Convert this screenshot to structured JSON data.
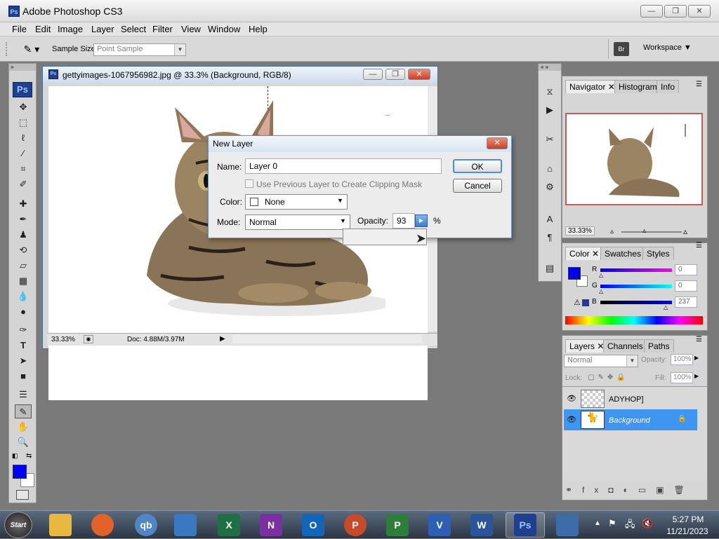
{
  "app": {
    "title": "Adobe Photoshop CS3",
    "icon_text": "Ps"
  },
  "window_buttons": {
    "minimize": "—",
    "restore": "❐",
    "close": "✕"
  },
  "menu": [
    "File",
    "Edit",
    "Image",
    "Layer",
    "Select",
    "Filter",
    "View",
    "Window",
    "Help"
  ],
  "options": {
    "sample_size_label": "Sample Size:",
    "sample_size_value": "Point Sample",
    "workspace_label": "Workspace ▼"
  },
  "toolbox": {
    "logo": "Ps",
    "tools": [
      "move-tool",
      "marquee-tool",
      "lasso-tool",
      "quick-select-tool",
      "crop-tool",
      "slice-tool",
      "healing-brush-tool",
      "brush-tool",
      "clone-stamp-tool",
      "history-brush-tool",
      "eraser-tool",
      "gradient-tool",
      "blur-tool",
      "dodge-tool",
      "pen-tool",
      "type-tool",
      "path-select-tool",
      "shape-tool",
      "notes-tool",
      "eyedropper-tool",
      "hand-tool",
      "zoom-tool"
    ],
    "foreground_color": "#0000ff",
    "background_color": "#ffffff"
  },
  "document": {
    "title": "gettyimages-1067956982.jpg @ 33.3% (Background, RGB/8)",
    "zoom": "33.33%",
    "doc_info": "Doc: 4.88M/3.97M"
  },
  "navigator": {
    "tabs": [
      "Navigator",
      "Histogram",
      "Info"
    ],
    "zoom": "33.33%"
  },
  "color_panel": {
    "tabs": [
      "Color",
      "Swatches",
      "Styles"
    ],
    "r_label": "R",
    "g_label": "G",
    "b_label": "B",
    "r_value": "0",
    "g_value": "0",
    "b_value": "237",
    "foreground": "#0000ed"
  },
  "layers_panel": {
    "tabs": [
      "Layers",
      "Channels",
      "Paths"
    ],
    "blend_mode": "Normal",
    "opacity_label": "Opacity:",
    "opacity_value": "100%",
    "lock_label": "Lock:",
    "fill_label": "Fill:",
    "fill_value": "100%",
    "layers": [
      {
        "name": "ADYHOP]",
        "selected": false
      },
      {
        "name": "Background",
        "selected": true
      }
    ]
  },
  "dialog": {
    "title": "New Layer",
    "name_label": "Name:",
    "name_value": "Layer 0",
    "clipping_label": "Use Previous Layer to Create Clipping Mask",
    "color_label": "Color:",
    "color_value": "None",
    "mode_label": "Mode:",
    "mode_value": "Normal",
    "opacity_label": "Opacity:",
    "opacity_value": "93",
    "percent": "%",
    "ok": "OK",
    "cancel": "Cancel"
  },
  "taskbar": {
    "start": "Start",
    "apps": [
      {
        "name": "file-explorer",
        "label": "",
        "color": "#e8b840"
      },
      {
        "name": "firefox",
        "label": "",
        "color": "#e2622a"
      },
      {
        "name": "quickbooks",
        "label": "qb",
        "color": "#4f86c7"
      },
      {
        "name": "remote-desktop",
        "label": "",
        "color": "#3a78c2"
      },
      {
        "name": "excel",
        "label": "X",
        "color": "#1d7044"
      },
      {
        "name": "onenote",
        "label": "N",
        "color": "#7b2fa0"
      },
      {
        "name": "outlook",
        "label": "O",
        "color": "#1265b8"
      },
      {
        "name": "powerpoint",
        "label": "P",
        "color": "#c64b28"
      },
      {
        "name": "project",
        "label": "P",
        "color": "#2f7d3b"
      },
      {
        "name": "visio",
        "label": "V",
        "color": "#2d5fb5"
      },
      {
        "name": "word",
        "label": "W",
        "color": "#2a5699"
      },
      {
        "name": "photoshop",
        "label": "Ps",
        "color": "#1f3f8f"
      },
      {
        "name": "installer",
        "label": "",
        "color": "#3d6da8"
      }
    ],
    "time": "5:27 PM",
    "date": "11/21/2023"
  }
}
